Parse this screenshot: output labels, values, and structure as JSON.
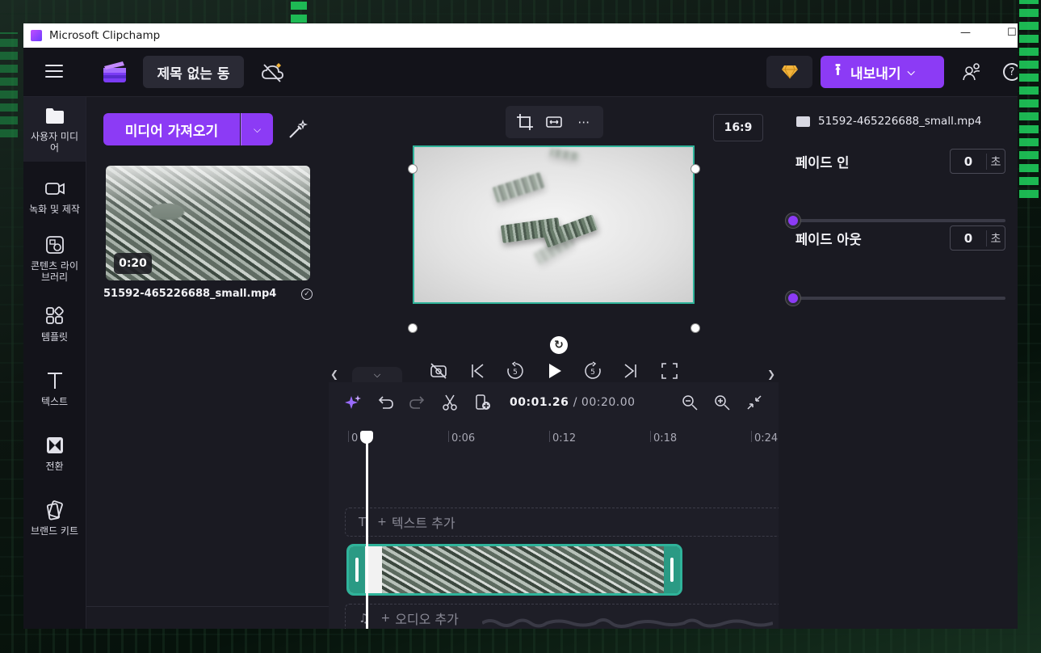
{
  "window": {
    "title": "Microsoft Clipchamp",
    "minimize": "—",
    "maximize": "☐"
  },
  "header": {
    "project_title": "제목 없는 동",
    "export_label": "내보내기"
  },
  "nav": [
    {
      "label": "사용자 미디어",
      "icon": "folder-icon"
    },
    {
      "label": "녹화 및 제작",
      "icon": "video-camera-icon"
    },
    {
      "label": "콘텐츠 라이브러리",
      "icon": "library-icon"
    },
    {
      "label": "템플릿",
      "icon": "templates-icon"
    },
    {
      "label": "텍스트",
      "icon": "text-icon"
    },
    {
      "label": "전환",
      "icon": "transition-icon"
    },
    {
      "label": "브랜드 키트",
      "icon": "brand-kit-icon"
    }
  ],
  "media": {
    "import_label": "미디어 가져오기",
    "items": [
      {
        "duration": "0:20",
        "name": "51592-465226688_small.mp4"
      }
    ]
  },
  "preview": {
    "aspect_ratio": "16:9"
  },
  "timeline": {
    "current_time": "00:01.26",
    "total_time": "/ 00:20.00",
    "ruler": [
      "0",
      "0:06",
      "0:12",
      "0:18",
      "0:24"
    ],
    "add_text": "텍스트 추가",
    "add_audio": "오디오 추가"
  },
  "properties": {
    "file_name": "51592-465226688_small.mp4",
    "fade_in": {
      "label": "페이드 인",
      "value": "0",
      "unit": "초",
      "level": 0
    },
    "fade_out": {
      "label": "페이드 아웃",
      "value": "0",
      "unit": "초",
      "level": 0
    }
  },
  "colors": {
    "accent": "#8c3bf5",
    "clip_border": "#2fb39a",
    "background": "#17171f"
  }
}
